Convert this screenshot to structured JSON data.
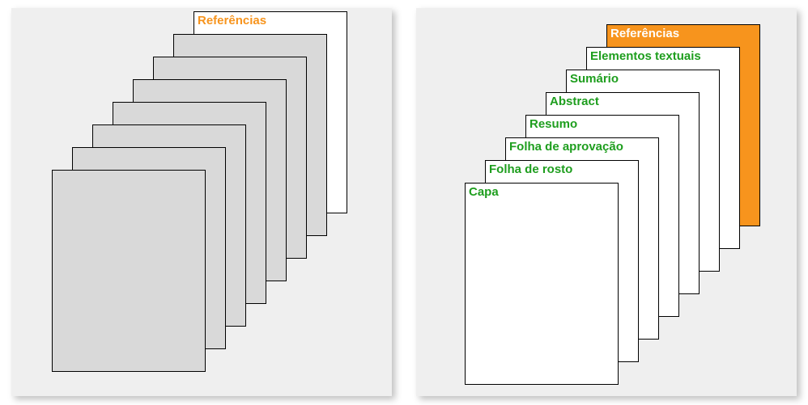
{
  "leftStack": {
    "topLabel": "Referências"
  },
  "rightStack": {
    "pages": [
      {
        "label": "Referências",
        "color": "white"
      },
      {
        "label": "Elementos textuais",
        "color": "green"
      },
      {
        "label": "Sumário",
        "color": "green"
      },
      {
        "label": "Abstract",
        "color": "green"
      },
      {
        "label": "Resumo",
        "color": "green"
      },
      {
        "label": "Folha de aprovação",
        "color": "green"
      },
      {
        "label": "Folha de rosto",
        "color": "green"
      },
      {
        "label": "Capa",
        "color": "green"
      }
    ]
  }
}
